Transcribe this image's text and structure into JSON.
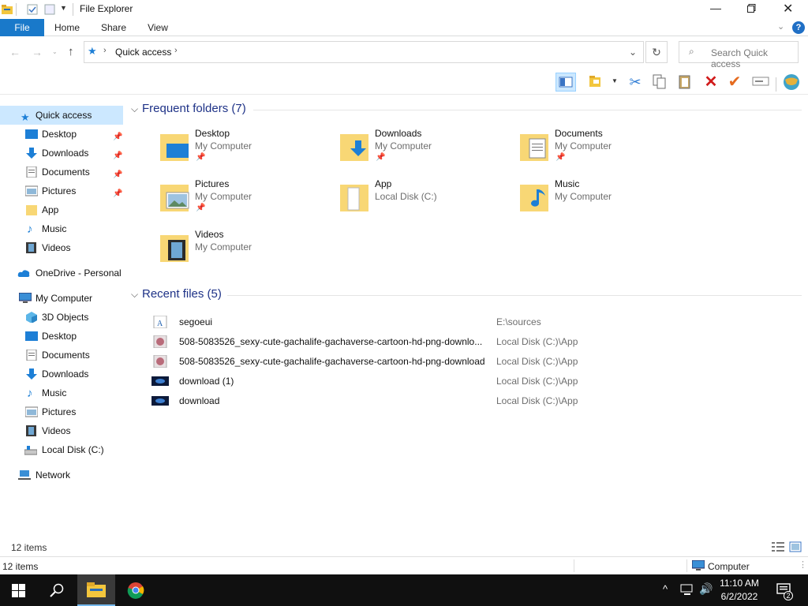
{
  "window": {
    "title": "File Explorer"
  },
  "ribbon": {
    "tabs": [
      "File",
      "Home",
      "Share",
      "View"
    ]
  },
  "address": {
    "location": "Quick access",
    "search_placeholder": "Search Quick access"
  },
  "nav": {
    "quick_access": "Quick access",
    "quick_items": [
      "Desktop",
      "Downloads",
      "Documents",
      "Pictures",
      "App",
      "Music",
      "Videos"
    ],
    "onedrive": "OneDrive - Personal",
    "this_pc": "My Computer",
    "pc_items": [
      "3D Objects",
      "Desktop",
      "Documents",
      "Downloads",
      "Music",
      "Pictures",
      "Videos",
      "Local Disk (C:)"
    ],
    "network": "Network"
  },
  "frequent": {
    "header": "Frequent folders (7)",
    "folders": [
      {
        "name": "Desktop",
        "location": "My Computer",
        "icon": "desktop-folder"
      },
      {
        "name": "Downloads",
        "location": "My Computer",
        "icon": "downloads-folder"
      },
      {
        "name": "Documents",
        "location": "My Computer",
        "icon": "documents-folder"
      },
      {
        "name": "Pictures",
        "location": "My Computer",
        "icon": "pictures-folder"
      },
      {
        "name": "App",
        "location": "Local Disk (C:)",
        "icon": "app-folder"
      },
      {
        "name": "Music",
        "location": "My Computer",
        "icon": "music-folder"
      },
      {
        "name": "Videos",
        "location": "My Computer",
        "icon": "videos-folder"
      }
    ]
  },
  "recent": {
    "header": "Recent files (5)",
    "files": [
      {
        "name": "segoeui",
        "location": "E:\\sources",
        "icon": "font-file"
      },
      {
        "name": "508-5083526_sexy-cute-gachalife-gachaverse-cartoon-hd-png-downlo...",
        "location": "Local Disk (C:)\\App",
        "icon": "image-file"
      },
      {
        "name": "508-5083526_sexy-cute-gachalife-gachaverse-cartoon-hd-png-download",
        "location": "Local Disk (C:)\\App",
        "icon": "image-file"
      },
      {
        "name": "download (1)",
        "location": "Local Disk (C:)\\App",
        "icon": "image-file-dark"
      },
      {
        "name": "download",
        "location": "Local Disk (C:)\\App",
        "icon": "image-file-dark"
      }
    ]
  },
  "status": {
    "items": "12 items",
    "bottom_items": "12 items",
    "computer": "Computer"
  },
  "taskbar": {
    "time": "11:10 AM",
    "date": "6/2/2022",
    "notifications": "2"
  },
  "colors": {
    "accent": "#1979ca",
    "folder": "#f8d775",
    "section": "#1e3287",
    "selected": "#cce8ff"
  }
}
